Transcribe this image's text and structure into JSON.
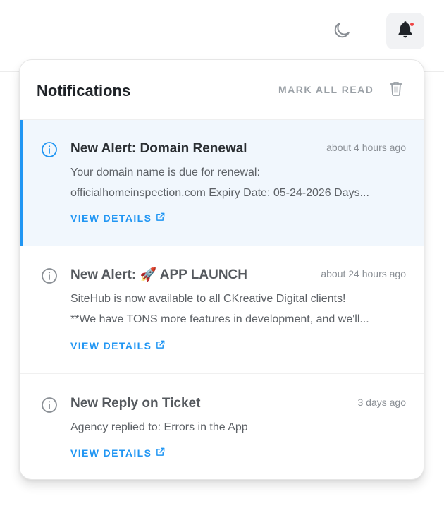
{
  "header": {
    "theme_toggle_icon": "moon-icon",
    "notifications_icon": "bell-icon",
    "has_unread_badge": true,
    "badge_color": "#ef4444"
  },
  "panel": {
    "title": "Notifications",
    "mark_all_read_label": "MARK ALL READ",
    "trash_icon": "trash-icon",
    "accent_color": "#2196f3"
  },
  "notifications": [
    {
      "title": "New Alert: Domain Renewal",
      "time": "about 4 hours ago",
      "body_lines": [
        "Your domain name is due for renewal:",
        "officialhomeinspection.com Expiry Date: 05-24-2026 Days..."
      ],
      "link_label": "VIEW DETAILS",
      "unread": true
    },
    {
      "title": "New Alert: 🚀 APP LAUNCH",
      "time": "about 24 hours ago",
      "body_lines": [
        "SiteHub is now available to all CKreative Digital clients!",
        "**We have TONS more features in development, and we'll..."
      ],
      "link_label": "VIEW DETAILS",
      "unread": false
    },
    {
      "title": "New Reply on Ticket",
      "time": "3 days ago",
      "body_lines": [
        "Agency replied to: Errors in the App"
      ],
      "link_label": "VIEW DETAILS",
      "unread": false
    }
  ]
}
